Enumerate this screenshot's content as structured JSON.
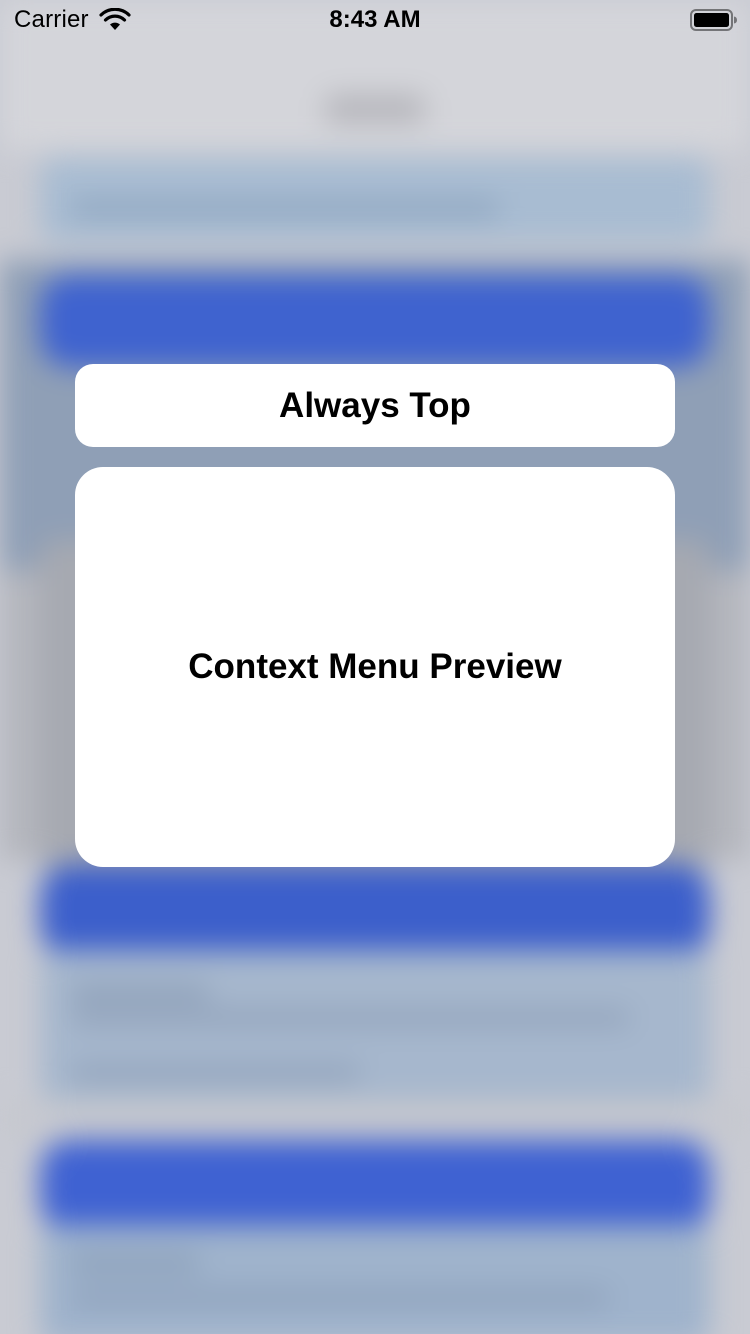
{
  "status_bar": {
    "carrier": "Carrier",
    "time": "8:43 AM",
    "wifi_icon": "wifi-icon",
    "battery_icon": "battery-icon"
  },
  "menu": {
    "always_top_label": "Always Top",
    "preview_label": "Context Menu Preview"
  },
  "colors": {
    "card_background": "#ffffff",
    "accent_blue": "#3f63cf",
    "overlay_gray": "#c9cbd3"
  }
}
